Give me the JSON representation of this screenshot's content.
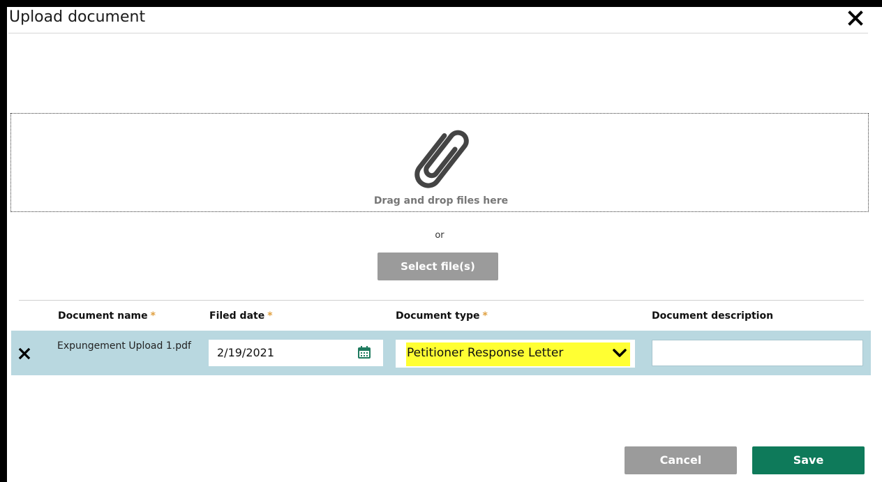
{
  "dialog": {
    "title": "Upload document"
  },
  "dropzone": {
    "text": "Drag and drop files here",
    "or_text": "or",
    "select_button": "Select file(s)"
  },
  "table": {
    "headers": {
      "document_name": "Document name",
      "filed_date": "Filed date",
      "document_type": "Document type",
      "document_description": "Document description"
    },
    "required_marker": "*",
    "rows": [
      {
        "document_name": "Expungement Upload 1.pdf",
        "filed_date": "2/19/2021",
        "document_type": "Petitioner Response Letter",
        "document_description": ""
      }
    ]
  },
  "footer": {
    "cancel_label": "Cancel",
    "save_label": "Save"
  },
  "colors": {
    "save_green": "#0e7a5a",
    "button_gray": "#9b9b9b",
    "row_blue": "#b9d8e0",
    "highlight_yellow": "#ffff33",
    "required_orange": "#e0a040"
  },
  "icons": [
    "close-icon",
    "paperclip-icon",
    "remove-row-icon",
    "calendar-icon",
    "chevron-down-icon"
  ]
}
